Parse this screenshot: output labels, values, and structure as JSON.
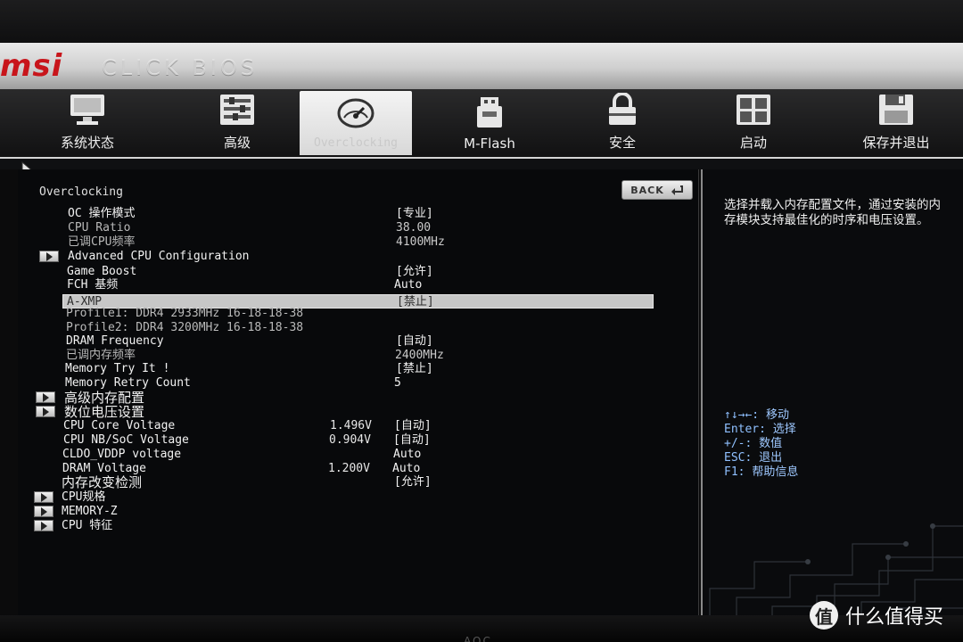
{
  "header": {
    "brand": "msi",
    "title": "CLICK BIOS"
  },
  "tabs": [
    {
      "id": "sys",
      "label": "系统状态",
      "icon": "monitor-icon"
    },
    {
      "id": "adv",
      "label": "高级",
      "icon": "settings-panel-icon"
    },
    {
      "id": "oc",
      "label": "Overclocking",
      "icon": "speedometer-icon",
      "active": true
    },
    {
      "id": "mflash",
      "label": "M-Flash",
      "icon": "usb-drive-icon"
    },
    {
      "id": "sec",
      "label": "安全",
      "icon": "lock-icon"
    },
    {
      "id": "boot",
      "label": "启动",
      "icon": "grid-boot-icon"
    },
    {
      "id": "save",
      "label": "保存并退出",
      "icon": "floppy-disk-icon"
    }
  ],
  "main": {
    "breadcrumb": "Overclocking",
    "back_label": "BACK",
    "rows": [
      {
        "name": "OC 操作模式",
        "value": "[专业]"
      },
      {
        "name": "CPU Ratio",
        "value": "38.00",
        "dim": true
      },
      {
        "name": "已调CPU频率",
        "value": "4100MHz",
        "dim": true
      },
      {
        "name": "Advanced CPU Configuration",
        "submenu": true
      },
      {
        "name": "Game Boost",
        "value": "[允许]"
      },
      {
        "name": "FCH 基频",
        "value": "Auto"
      },
      {
        "name": "A-XMP",
        "value": "[禁止]",
        "selected": true
      },
      {
        "name": "Profile1: DDR4 2933MHz 16-18-18-38",
        "dim": true
      },
      {
        "name": "Profile2: DDR4 3200MHz 16-18-18-38",
        "dim": true
      },
      {
        "name": "DRAM Frequency",
        "value": "[自动]"
      },
      {
        "name": "已调内存频率",
        "value": "2400MHz",
        "dim": true
      },
      {
        "name": "Memory Try It !",
        "value": "[禁止]"
      },
      {
        "name": "Memory Retry Count",
        "value": "5"
      },
      {
        "name": "高级内存配置",
        "submenu": true
      },
      {
        "name": "数位电压设置",
        "submenu": true
      },
      {
        "name": "CPU Core Voltage",
        "current": "1.496V",
        "value": "[自动]"
      },
      {
        "name": "CPU NB/SoC Voltage",
        "current": "0.904V",
        "value": "[自动]"
      },
      {
        "name": "CLDO_VDDP voltage",
        "value": "Auto"
      },
      {
        "name": "DRAM Voltage",
        "current": "1.200V",
        "value": "Auto"
      },
      {
        "name": "内存改变检测",
        "value": "[允许]"
      },
      {
        "name": "CPU规格",
        "submenu": true
      },
      {
        "name": "MEMORY-Z",
        "submenu": true
      },
      {
        "name": "CPU 特征",
        "submenu": true
      }
    ]
  },
  "help": {
    "description": "选择并载入内存配置文件，通过安装的内存模块支持最佳化的时序和电压设置。",
    "keys": [
      {
        "key": "↑↓→←:",
        "action": "移动"
      },
      {
        "key": "Enter:",
        "action": "选择"
      },
      {
        "key": "+/-:",
        "action": "数值"
      },
      {
        "key": "ESC:",
        "action": "退出"
      },
      {
        "key": "F1:",
        "action": "帮助信息"
      }
    ]
  },
  "watermark": {
    "logo": "值",
    "text": "什么值得买"
  },
  "bezel": {
    "brand": "AOC"
  }
}
